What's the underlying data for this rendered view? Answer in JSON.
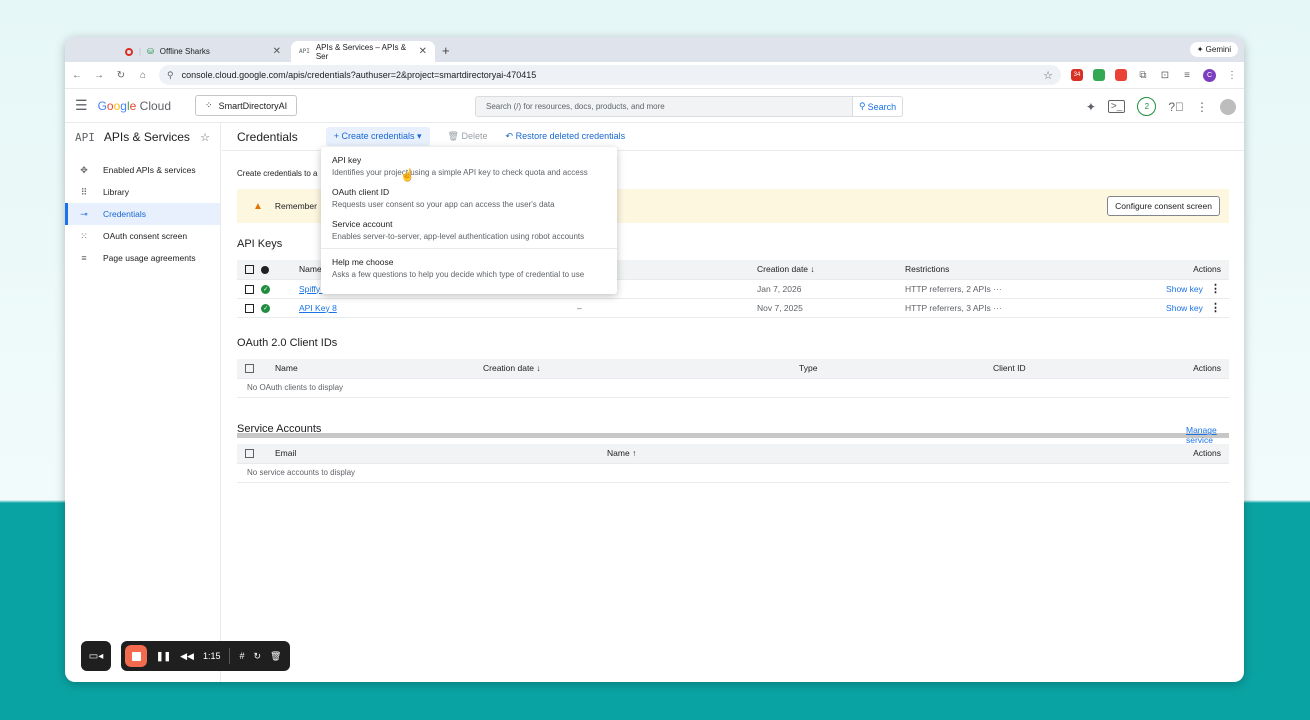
{
  "browser": {
    "tabs": [
      {
        "title": "Offline Sharks"
      },
      {
        "title": "APIs & Services – APIs & Ser"
      }
    ],
    "gemini_label": "Gemini",
    "url": "console.cloud.google.com/apis/credentials?authuser=2&project=smartdirectoryai-470415",
    "extension_badge": "34",
    "profile_initial": "C"
  },
  "header": {
    "logo": {
      "g1": "G",
      "o1": "o",
      "o2": "o",
      "g2": "g",
      "l": "l",
      "e": "e",
      "cloud": " Cloud"
    },
    "project": "SmartDirectoryAI",
    "search_placeholder": "Search (/) for resources, docs, products, and more",
    "search_button": "Search",
    "notification_count": "2"
  },
  "sidebar": {
    "title": "APIs & Services",
    "api_mark": "API",
    "items": [
      {
        "label": "Enabled APIs & services",
        "icon": "diamond-icon"
      },
      {
        "label": "Library",
        "icon": "grid-icon"
      },
      {
        "label": "Credentials",
        "icon": "key-icon",
        "active": true
      },
      {
        "label": "OAuth consent screen",
        "icon": "dots-icon"
      },
      {
        "label": "Page usage agreements",
        "icon": "settings-list-icon"
      }
    ]
  },
  "actions": {
    "page_title": "Credentials",
    "create": "Create credentials",
    "delete": "Delete",
    "restore": "Restore deleted credentials"
  },
  "intro_text": "Create credentials to a",
  "banner": {
    "text_before": "Remember",
    "text_after": "n.",
    "button": "Configure consent screen"
  },
  "dropdown": {
    "items": [
      {
        "title": "API key",
        "desc": "Identifies your project using a simple API key to check quota and access"
      },
      {
        "title": "OAuth client ID",
        "desc": "Requests user consent so your app can access the user's data"
      },
      {
        "title": "Service account",
        "desc": "Enables server-to-server, app-level authentication using robot accounts"
      },
      {
        "title": "Help me choose",
        "desc": "Asks a few questions to help you decide which type of credential to use"
      }
    ]
  },
  "api_keys": {
    "title": "API Keys",
    "headers": {
      "name": "Name",
      "account": "unt",
      "created": "Creation date",
      "restrictions": "Restrictions",
      "actions": "Actions"
    },
    "rows": [
      {
        "name": "Spiffy c",
        "account": "",
        "created": "Jan 7, 2026",
        "restrictions": "HTTP referrers, 2 APIs",
        "action": "Show key"
      },
      {
        "name": "API Key 8",
        "account": "–",
        "created": "Nov 7, 2025",
        "restrictions": "HTTP referrers, 3 APIs",
        "action": "Show key"
      }
    ]
  },
  "oauth": {
    "title": "OAuth 2.0 Client IDs",
    "headers": {
      "name": "Name",
      "created": "Creation date",
      "type": "Type",
      "client_id": "Client ID",
      "actions": "Actions"
    },
    "empty": "No OAuth clients to display"
  },
  "service_accounts": {
    "title": "Service Accounts",
    "manage_link": "Manage service accounts",
    "headers": {
      "email": "Email",
      "name": "Name",
      "actions": "Actions"
    },
    "empty": "No service accounts to display"
  },
  "recorder": {
    "time": "1:15"
  }
}
